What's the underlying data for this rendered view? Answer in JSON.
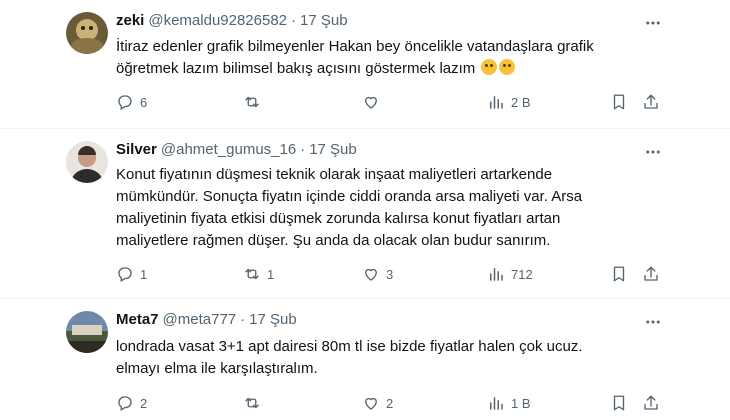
{
  "tweets": [
    {
      "name": "zeki",
      "handle": "@kemaldu92826582",
      "dot": "·",
      "date": "17 Şub",
      "text": "İtiraz edenler grafik bilmeyenler Hakan bey öncelikle vatandaşlara grafik öğretmek lazım bilimsel bakış açısını göstermek lazım",
      "emojis": [
        "face-with-tears-of-joy",
        "relieved-face"
      ],
      "replies": "6",
      "retweets": "",
      "likes": "",
      "views": "2 B"
    },
    {
      "name": "Silver",
      "handle": "@ahmet_gumus_16",
      "dot": "·",
      "date": "17 Şub",
      "text": "Konut fiyatının düşmesi teknik olarak inşaat maliyetleri artarkende mümkündür. Sonuçta fiyatın içinde ciddi oranda arsa maliyeti var. Arsa maliyetinin fiyata etkisi düşmek zorunda kalırsa konut fiyatları artan maliyetlere rağmen düşer. Şu anda da olacak olan budur sanırım.",
      "replies": "1",
      "retweets": "1",
      "likes": "3",
      "views": "712"
    },
    {
      "name": "Meta7",
      "handle": "@meta777",
      "dot": "·",
      "date": "17 Şub",
      "text": "londrada vasat 3+1 apt dairesi 80m tl ise bizde fiyatlar halen çok ucuz. elmayı elma ile karşılaştıralım.",
      "replies": "2",
      "retweets": "",
      "likes": "2",
      "views": "1 B"
    }
  ],
  "colors": {
    "text": "#0f1419",
    "secondary": "#536471",
    "divider": "#eff3f4"
  },
  "icons": [
    "more-icon",
    "reply-icon",
    "retweet-icon",
    "like-icon",
    "views-icon",
    "bookmark-icon",
    "share-icon"
  ]
}
